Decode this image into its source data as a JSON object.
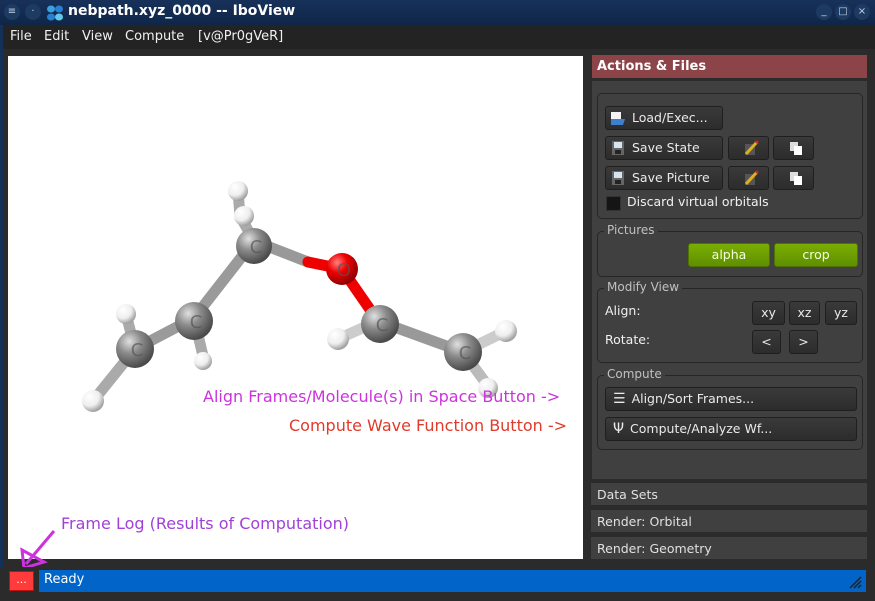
{
  "window": {
    "title": "nebpath.xyz_0000 -- IboView",
    "controls": {
      "menu": "≡",
      "sticky": "·",
      "minimize": "_",
      "maximize": "□",
      "close": "×"
    }
  },
  "menubar": {
    "items": [
      "File",
      "Edit",
      "View",
      "Compute",
      "[v@Pr0gVeR]"
    ]
  },
  "viewport": {
    "molecule": {
      "atoms": [
        {
          "element": "H",
          "label": ""
        },
        {
          "element": "H",
          "label": ""
        },
        {
          "element": "C",
          "label": "C"
        },
        {
          "element": "O",
          "label": "O"
        },
        {
          "element": "C",
          "label": "C"
        },
        {
          "element": "C",
          "label": "C"
        },
        {
          "element": "C",
          "label": "C"
        },
        {
          "element": "C",
          "label": "C"
        }
      ],
      "colors": {
        "carbon": "#8a8a8a",
        "oxygen": "#ee0000",
        "hydrogen": "#f2f2f2"
      }
    }
  },
  "annotations": {
    "align": "Align Frames/Molecule(s) in Space Button ->",
    "compute": "Compute Wave Function Button ->",
    "log": "Frame Log (Results of Computation)",
    "colors": {
      "align": "#cc33dd",
      "compute": "#e03a2a",
      "log": "#a040d8"
    }
  },
  "panel": {
    "header": "Actions & Files",
    "header_color": "#8c4448",
    "files": {
      "load_exec": "Load/Exec...",
      "save_state": "Save State",
      "save_picture": "Save Picture",
      "discard_virtual": "Discard virtual orbitals",
      "discard_checked": false
    },
    "pictures": {
      "title": "Pictures",
      "alpha": "alpha",
      "crop": "crop",
      "accent": "#6fa300"
    },
    "modify_view": {
      "title": "Modify View",
      "align_label": "Align:",
      "align_buttons": [
        "xy",
        "xz",
        "yz"
      ],
      "rotate_label": "Rotate:",
      "rotate_buttons": [
        "<",
        ">"
      ]
    },
    "compute": {
      "title": "Compute",
      "align_sort": "Align/Sort Frames...",
      "align_sort_icon": "☰",
      "compute_analyze": "Compute/Analyze Wf...",
      "compute_analyze_icon": "Ψ"
    },
    "sections": [
      "Data Sets",
      "Render: Orbital",
      "Render: Geometry"
    ]
  },
  "status": {
    "log_button": "...",
    "text": "Ready",
    "bar_color": "#0064c8"
  }
}
